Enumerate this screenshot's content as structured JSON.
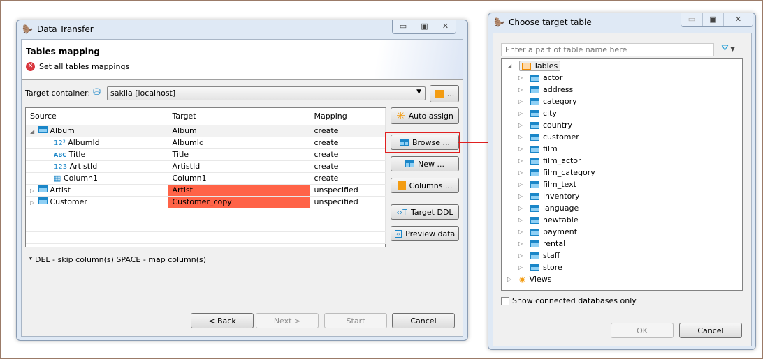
{
  "left": {
    "title": "Data Transfer",
    "heading": "Tables mapping",
    "error": "Set all tables mappings",
    "target_label": "Target container:",
    "target_value": "sakila  [localhost]",
    "folder_btn": "...",
    "columns": [
      "Source",
      "Target",
      "Mapping"
    ],
    "rows": [
      {
        "source": "Album",
        "target": "Album",
        "mapping": "create",
        "kind": "table",
        "expanded": true,
        "error": false
      },
      {
        "source": "AlbumId",
        "target": "AlbumId",
        "mapping": "create",
        "kind": "num-key",
        "error": false
      },
      {
        "source": "Title",
        "target": "Title",
        "mapping": "create",
        "kind": "text",
        "error": false
      },
      {
        "source": "ArtistId",
        "target": "ArtistId",
        "mapping": "create",
        "kind": "num",
        "error": false
      },
      {
        "source": "Column1",
        "target": "Column1",
        "mapping": "create",
        "kind": "doc",
        "error": false
      },
      {
        "source": "Artist",
        "target": "Artist",
        "mapping": "unspecified",
        "kind": "table",
        "error": true
      },
      {
        "source": "Customer",
        "target": "Customer_copy",
        "mapping": "unspecified",
        "kind": "table",
        "error": true
      }
    ],
    "buttons": {
      "auto": "Auto assign",
      "browse": "Browse ...",
      "new": "New ...",
      "columns": "Columns ...",
      "ddl": "Target DDL",
      "preview": "Preview data"
    },
    "hint": "* DEL - skip column(s)  SPACE - map column(s)",
    "footer": {
      "back": "< Back",
      "next": "Next >",
      "start": "Start",
      "cancel": "Cancel"
    }
  },
  "right": {
    "title": "Choose target table",
    "search_placeholder": "Enter a part of table name here",
    "tables_label": "Tables",
    "tables": [
      "actor",
      "address",
      "category",
      "city",
      "country",
      "customer",
      "film",
      "film_actor",
      "film_category",
      "film_text",
      "inventory",
      "language",
      "newtable",
      "payment",
      "rental",
      "staff",
      "store"
    ],
    "views_label": "Views",
    "checkbox": "Show connected databases only",
    "ok": "OK",
    "cancel": "Cancel"
  },
  "colors": {
    "error": "#ff6347",
    "highlight": "#e02020"
  }
}
